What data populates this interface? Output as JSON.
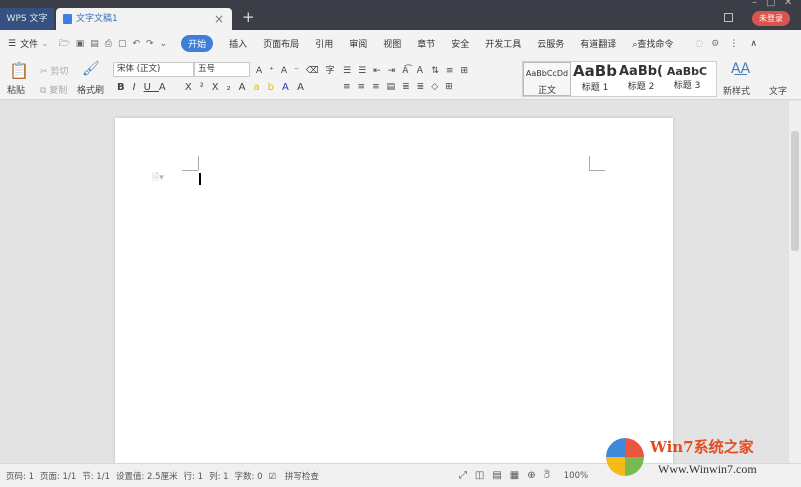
{
  "titlebar": {
    "app_tab": "WPS 文字",
    "doc_tab": "文字文稿1",
    "login": "未登录"
  },
  "menubar": {
    "file": "文件",
    "tabs": [
      "开始",
      "插入",
      "页面布局",
      "引用",
      "审阅",
      "视图",
      "章节",
      "安全",
      "开发工具",
      "云服务",
      "有道翻译"
    ],
    "search": "查找命令",
    "active_tab": "开始"
  },
  "ribbon": {
    "paste": "粘贴",
    "cut": "剪切",
    "copy": "复制",
    "format_painter": "格式刷",
    "font_name": "宋体 (正文)",
    "font_size": "五号",
    "styles": [
      {
        "preview": "AaBbCcDd",
        "label": "正文"
      },
      {
        "preview": "AaBb",
        "label": "标题 1"
      },
      {
        "preview": "AaBb(",
        "label": "标题 2"
      },
      {
        "preview": "AaBbC",
        "label": "标题 3"
      }
    ],
    "new_style": "新样式",
    "text_tools": "文字"
  },
  "status": {
    "page_num": "页码: 1",
    "pages": "页面: 1/1",
    "section": "节: 1/1",
    "setting": "设置值: 2.5厘米",
    "row": "行: 1",
    "col": "列: 1",
    "words": "字数: 0",
    "spell": "拼写检查",
    "zoom": "100%"
  },
  "watermark": {
    "brand": "Win7系统之家",
    "url": "Www.Winwin7.com"
  },
  "colors": {
    "titlebar": "#3b3e46",
    "accent": "#3f7fd9",
    "login": "#d9534f"
  }
}
